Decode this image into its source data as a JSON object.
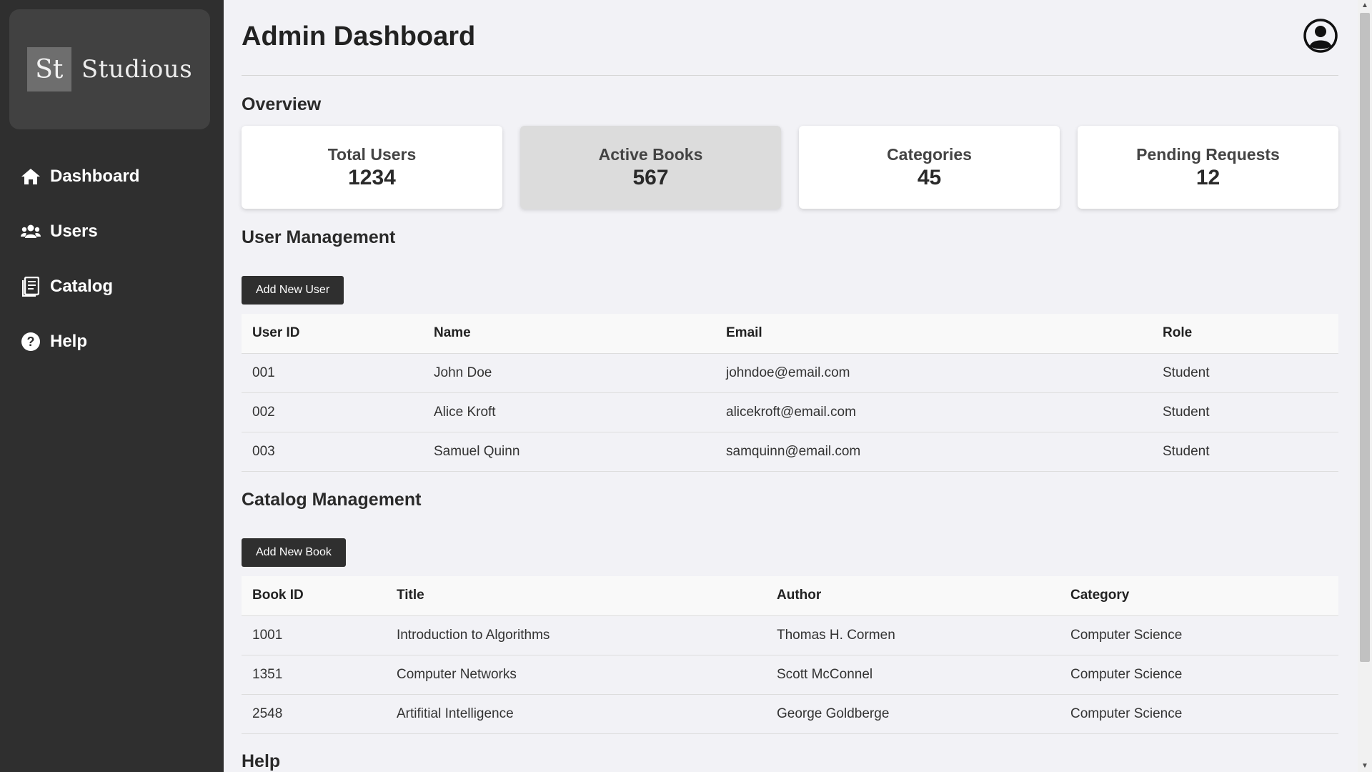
{
  "brand": {
    "mark": "St",
    "name": "Studious"
  },
  "sidebar": {
    "items": [
      {
        "label": "Dashboard",
        "icon": "home-icon"
      },
      {
        "label": "Users",
        "icon": "users-icon"
      },
      {
        "label": "Catalog",
        "icon": "catalog-icon"
      },
      {
        "label": "Help",
        "icon": "help-icon"
      }
    ]
  },
  "header": {
    "title": "Admin Dashboard",
    "profile_icon": "user-circle-icon"
  },
  "overview": {
    "title": "Overview",
    "cards": [
      {
        "label": "Total Users",
        "value": "1234"
      },
      {
        "label": "Active Books",
        "value": "567"
      },
      {
        "label": "Categories",
        "value": "45"
      },
      {
        "label": "Pending Requests",
        "value": "12"
      }
    ]
  },
  "users": {
    "title": "User Management",
    "add_label": "Add New User",
    "columns": [
      "User ID",
      "Name",
      "Email",
      "Role"
    ],
    "rows": [
      [
        "001",
        "John Doe",
        "johndoe@email.com",
        "Student"
      ],
      [
        "002",
        "Alice Kroft",
        "alicekroft@email.com",
        "Student"
      ],
      [
        "003",
        "Samuel Quinn",
        "samquinn@email.com",
        "Student"
      ]
    ]
  },
  "catalog": {
    "title": "Catalog Management",
    "add_label": "Add New Book",
    "columns": [
      "Book ID",
      "Title",
      "Author",
      "Category"
    ],
    "rows": [
      [
        "1001",
        "Introduction to Algorithms",
        "Thomas H. Cormen",
        "Computer Science"
      ],
      [
        "1351",
        "Computer Networks",
        "Scott McConnel",
        "Computer Science"
      ],
      [
        "2548",
        "Artifitial Intelligence",
        "George Goldberge",
        "Computer Science"
      ]
    ]
  },
  "help": {
    "title": "Help"
  },
  "colors": {
    "sidebar_bg": "#2f2f2f",
    "page_bg": "#f2f2f6",
    "button_bg": "#2f2f2f",
    "active_card_bg": "#dcdcdc"
  }
}
